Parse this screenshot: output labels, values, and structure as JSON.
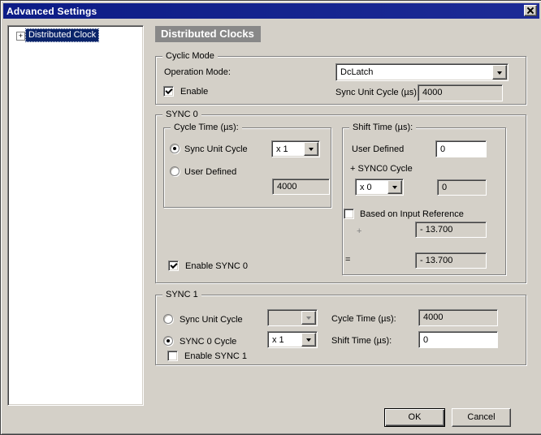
{
  "window": {
    "title": "Advanced Settings"
  },
  "tree": {
    "expand_glyph": "+",
    "items": [
      {
        "label": "Distributed Clock"
      }
    ]
  },
  "header": {
    "title": "Distributed Clocks"
  },
  "cyclic_mode": {
    "legend": "Cyclic Mode",
    "operation_mode_label": "Operation Mode:",
    "operation_mode_value": "DcLatch",
    "enable_label": "Enable",
    "sync_unit_cycle_label": "Sync Unit Cycle (µs):",
    "sync_unit_cycle_value": "4000"
  },
  "sync0": {
    "legend": "SYNC 0",
    "cycle_time": {
      "legend": "Cycle Time (µs):",
      "radio_sync_unit_label": "Sync Unit Cycle",
      "multiplier_value": "x 1",
      "radio_user_defined_label": "User Defined",
      "cycle_value": "4000"
    },
    "shift_time": {
      "legend": "Shift Time (µs):",
      "user_defined_label": "User Defined",
      "user_defined_value": "0",
      "sync0_cycle_label": "+ SYNC0 Cycle",
      "multiplier_value": "x 0",
      "cycle_value": "0",
      "based_on_input_label": "Based on Input Reference",
      "plus_label": "+",
      "plus_value": "- 13.700",
      "equals_label": "=",
      "equals_value": "- 13.700"
    },
    "enable_label": "Enable SYNC 0"
  },
  "sync1": {
    "legend": "SYNC 1",
    "radio_sync_unit_label": "Sync Unit Cycle",
    "radio_sync0_label": "SYNC 0 Cycle",
    "multiplier_value": "x 1",
    "cycle_time_label": "Cycle Time (µs):",
    "cycle_time_value": "4000",
    "shift_time_label": "Shift Time (µs):",
    "shift_time_value": "0",
    "enable_label": "Enable SYNC 1"
  },
  "footer": {
    "ok_label": "OK",
    "cancel_label": "Cancel"
  },
  "colors": {
    "titlebar": "#0c1c86",
    "dialog_bg": "#d4d0c8",
    "selection": "#0a246a",
    "header_bg": "#888888"
  }
}
